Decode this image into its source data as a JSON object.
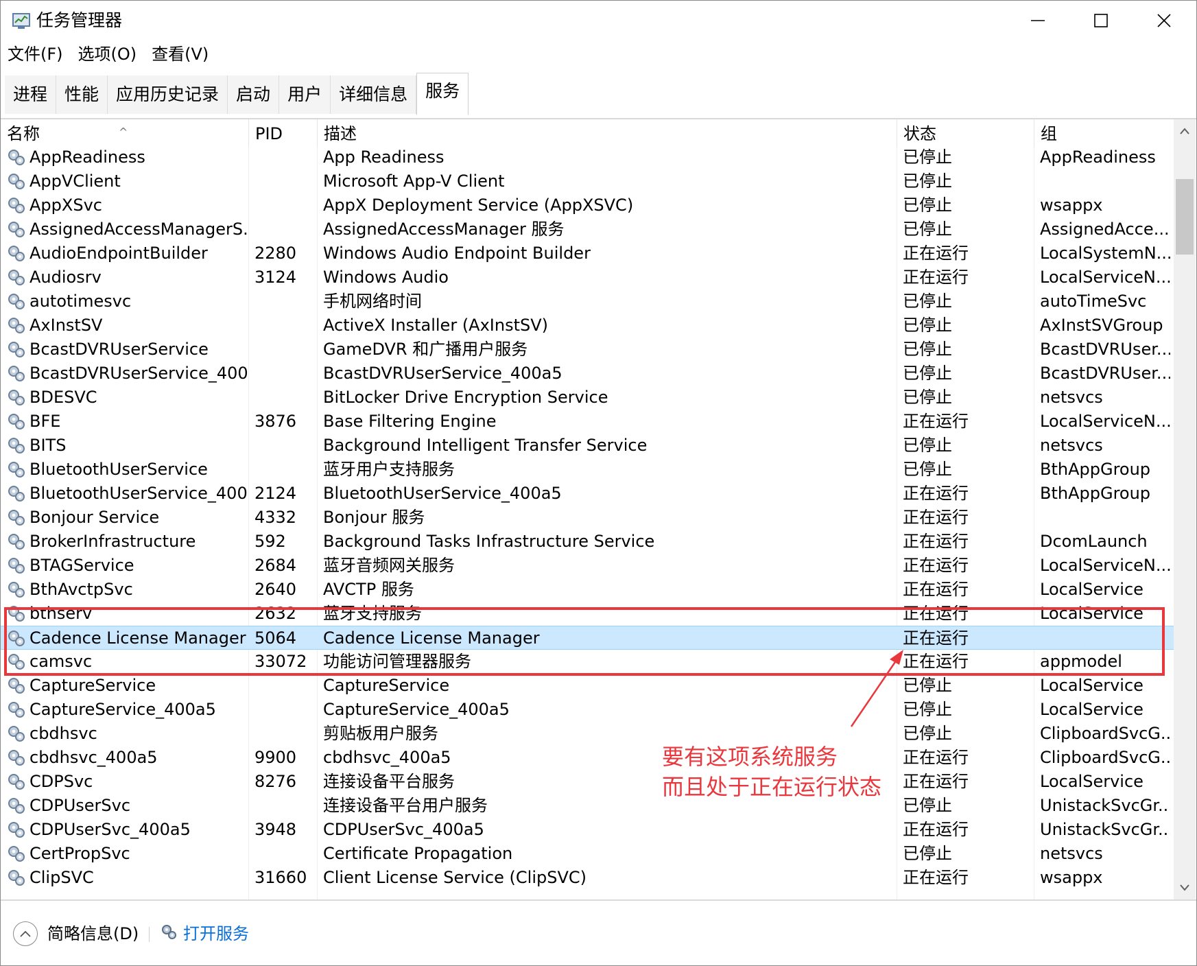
{
  "window": {
    "title": "任务管理器",
    "controls": {
      "minimize": "minimize",
      "maximize": "maximize",
      "close": "close"
    }
  },
  "menu": [
    "文件(F)",
    "选项(O)",
    "查看(V)"
  ],
  "tabs": [
    {
      "label": "进程",
      "active": false
    },
    {
      "label": "性能",
      "active": false
    },
    {
      "label": "应用历史记录",
      "active": false
    },
    {
      "label": "启动",
      "active": false
    },
    {
      "label": "用户",
      "active": false
    },
    {
      "label": "详细信息",
      "active": false
    },
    {
      "label": "服务",
      "active": true
    }
  ],
  "table": {
    "columns": {
      "name": "名称",
      "pid": "PID",
      "desc": "描述",
      "status": "状态",
      "group": "组"
    },
    "sort_indicator": "^",
    "rows": [
      {
        "name": "AppReadiness",
        "pid": "",
        "desc": "App Readiness",
        "status": "已停止",
        "group": "AppReadiness"
      },
      {
        "name": "AppVClient",
        "pid": "",
        "desc": "Microsoft App-V Client",
        "status": "已停止",
        "group": ""
      },
      {
        "name": "AppXSvc",
        "pid": "",
        "desc": "AppX Deployment Service (AppXSVC)",
        "status": "已停止",
        "group": "wsappx"
      },
      {
        "name": "AssignedAccessManagerS...",
        "pid": "",
        "desc": "AssignedAccessManager 服务",
        "status": "已停止",
        "group": "AssignedAcce..."
      },
      {
        "name": "AudioEndpointBuilder",
        "pid": "2280",
        "desc": "Windows Audio Endpoint Builder",
        "status": "正在运行",
        "group": "LocalSystemN..."
      },
      {
        "name": "Audiosrv",
        "pid": "3124",
        "desc": "Windows Audio",
        "status": "正在运行",
        "group": "LocalServiceN..."
      },
      {
        "name": "autotimesvc",
        "pid": "",
        "desc": "手机网络时间",
        "status": "已停止",
        "group": "autoTimeSvc"
      },
      {
        "name": "AxInstSV",
        "pid": "",
        "desc": "ActiveX Installer (AxInstSV)",
        "status": "已停止",
        "group": "AxInstSVGroup"
      },
      {
        "name": "BcastDVRUserService",
        "pid": "",
        "desc": "GameDVR 和广播用户服务",
        "status": "已停止",
        "group": "BcastDVRUser..."
      },
      {
        "name": "BcastDVRUserService_400...",
        "pid": "",
        "desc": "BcastDVRUserService_400a5",
        "status": "已停止",
        "group": "BcastDVRUser..."
      },
      {
        "name": "BDESVC",
        "pid": "",
        "desc": "BitLocker Drive Encryption Service",
        "status": "已停止",
        "group": "netsvcs"
      },
      {
        "name": "BFE",
        "pid": "3876",
        "desc": "Base Filtering Engine",
        "status": "正在运行",
        "group": "LocalServiceN..."
      },
      {
        "name": "BITS",
        "pid": "",
        "desc": "Background Intelligent Transfer Service",
        "status": "已停止",
        "group": "netsvcs"
      },
      {
        "name": "BluetoothUserService",
        "pid": "",
        "desc": "蓝牙用户支持服务",
        "status": "已停止",
        "group": "BthAppGroup"
      },
      {
        "name": "BluetoothUserService_400...",
        "pid": "2124",
        "desc": "BluetoothUserService_400a5",
        "status": "正在运行",
        "group": "BthAppGroup"
      },
      {
        "name": "Bonjour Service",
        "pid": "4332",
        "desc": "Bonjour 服务",
        "status": "正在运行",
        "group": ""
      },
      {
        "name": "BrokerInfrastructure",
        "pid": "592",
        "desc": "Background Tasks Infrastructure Service",
        "status": "正在运行",
        "group": "DcomLaunch"
      },
      {
        "name": "BTAGService",
        "pid": "2684",
        "desc": "蓝牙音频网关服务",
        "status": "正在运行",
        "group": "LocalServiceN..."
      },
      {
        "name": "BthAvctpSvc",
        "pid": "2640",
        "desc": "AVCTP 服务",
        "status": "正在运行",
        "group": "LocalService"
      },
      {
        "name": "bthserv",
        "pid": "2632",
        "desc": "蓝牙支持服务",
        "status": "正在运行",
        "group": "LocalService"
      },
      {
        "name": "Cadence License Manager",
        "pid": "5064",
        "desc": "Cadence License Manager",
        "status": "正在运行",
        "group": "",
        "selected": true
      },
      {
        "name": "camsvc",
        "pid": "33072",
        "desc": "功能访问管理器服务",
        "status": "正在运行",
        "group": "appmodel"
      },
      {
        "name": "CaptureService",
        "pid": "",
        "desc": "CaptureService",
        "status": "已停止",
        "group": "LocalService"
      },
      {
        "name": "CaptureService_400a5",
        "pid": "",
        "desc": "CaptureService_400a5",
        "status": "已停止",
        "group": "LocalService"
      },
      {
        "name": "cbdhsvc",
        "pid": "",
        "desc": "剪贴板用户服务",
        "status": "已停止",
        "group": "ClipboardSvcG..."
      },
      {
        "name": "cbdhsvc_400a5",
        "pid": "9900",
        "desc": "cbdhsvc_400a5",
        "status": "正在运行",
        "group": "ClipboardSvcG..."
      },
      {
        "name": "CDPSvc",
        "pid": "8276",
        "desc": "连接设备平台服务",
        "status": "正在运行",
        "group": "LocalService"
      },
      {
        "name": "CDPUserSvc",
        "pid": "",
        "desc": "连接设备平台用户服务",
        "status": "已停止",
        "group": "UnistackSvcGr..."
      },
      {
        "name": "CDPUserSvc_400a5",
        "pid": "3948",
        "desc": "CDPUserSvc_400a5",
        "status": "正在运行",
        "group": "UnistackSvcGr..."
      },
      {
        "name": "CertPropSvc",
        "pid": "",
        "desc": "Certificate Propagation",
        "status": "已停止",
        "group": "netsvcs"
      },
      {
        "name": "ClipSVC",
        "pid": "31660",
        "desc": "Client License Service (ClipSVC)",
        "status": "正在运行",
        "group": "wsappx"
      }
    ]
  },
  "footer": {
    "fewer_details": "简略信息(D)",
    "open_services": "打开服务"
  },
  "annotation": {
    "lines": [
      "要有这项系统服务",
      "而且处于正在运行状态"
    ],
    "color": "#e8383d"
  },
  "colors": {
    "selection": "#cce8ff",
    "link": "#0a6fd8",
    "annotation": "#e8383d"
  }
}
